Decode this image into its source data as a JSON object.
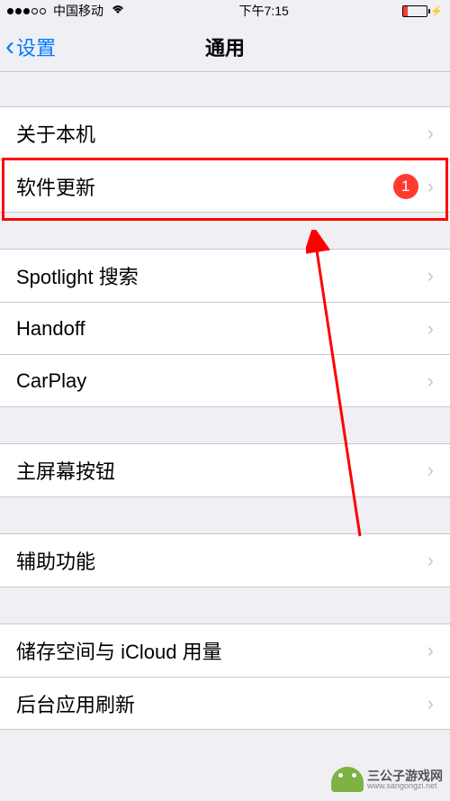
{
  "statusBar": {
    "carrier": "中国移动",
    "time": "下午7:15"
  },
  "nav": {
    "back": "设置",
    "title": "通用"
  },
  "sections": [
    {
      "rows": [
        {
          "label": "关于本机",
          "badge": null
        },
        {
          "label": "软件更新",
          "badge": "1"
        }
      ]
    },
    {
      "rows": [
        {
          "label": "Spotlight 搜索",
          "badge": null
        },
        {
          "label": "Handoff",
          "badge": null
        },
        {
          "label": "CarPlay",
          "badge": null
        }
      ]
    },
    {
      "rows": [
        {
          "label": "主屏幕按钮",
          "badge": null
        }
      ]
    },
    {
      "rows": [
        {
          "label": "辅助功能",
          "badge": null
        }
      ]
    },
    {
      "rows": [
        {
          "label": "储存空间与 iCloud 用量",
          "badge": null
        },
        {
          "label": "后台应用刷新",
          "badge": null
        }
      ]
    }
  ],
  "watermark": {
    "name": "三公子游戏网",
    "url": "www.sangongzi.net"
  }
}
